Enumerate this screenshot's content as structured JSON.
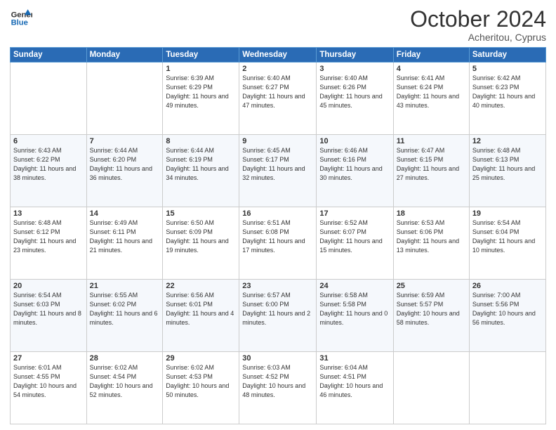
{
  "logo": {
    "line1": "General",
    "line2": "Blue"
  },
  "title": "October 2024",
  "subtitle": "Acheritou, Cyprus",
  "days_of_week": [
    "Sunday",
    "Monday",
    "Tuesday",
    "Wednesday",
    "Thursday",
    "Friday",
    "Saturday"
  ],
  "weeks": [
    [
      {
        "day": "",
        "info": ""
      },
      {
        "day": "",
        "info": ""
      },
      {
        "day": "1",
        "info": "Sunrise: 6:39 AM\nSunset: 6:29 PM\nDaylight: 11 hours and 49 minutes."
      },
      {
        "day": "2",
        "info": "Sunrise: 6:40 AM\nSunset: 6:27 PM\nDaylight: 11 hours and 47 minutes."
      },
      {
        "day": "3",
        "info": "Sunrise: 6:40 AM\nSunset: 6:26 PM\nDaylight: 11 hours and 45 minutes."
      },
      {
        "day": "4",
        "info": "Sunrise: 6:41 AM\nSunset: 6:24 PM\nDaylight: 11 hours and 43 minutes."
      },
      {
        "day": "5",
        "info": "Sunrise: 6:42 AM\nSunset: 6:23 PM\nDaylight: 11 hours and 40 minutes."
      }
    ],
    [
      {
        "day": "6",
        "info": "Sunrise: 6:43 AM\nSunset: 6:22 PM\nDaylight: 11 hours and 38 minutes."
      },
      {
        "day": "7",
        "info": "Sunrise: 6:44 AM\nSunset: 6:20 PM\nDaylight: 11 hours and 36 minutes."
      },
      {
        "day": "8",
        "info": "Sunrise: 6:44 AM\nSunset: 6:19 PM\nDaylight: 11 hours and 34 minutes."
      },
      {
        "day": "9",
        "info": "Sunrise: 6:45 AM\nSunset: 6:17 PM\nDaylight: 11 hours and 32 minutes."
      },
      {
        "day": "10",
        "info": "Sunrise: 6:46 AM\nSunset: 6:16 PM\nDaylight: 11 hours and 30 minutes."
      },
      {
        "day": "11",
        "info": "Sunrise: 6:47 AM\nSunset: 6:15 PM\nDaylight: 11 hours and 27 minutes."
      },
      {
        "day": "12",
        "info": "Sunrise: 6:48 AM\nSunset: 6:13 PM\nDaylight: 11 hours and 25 minutes."
      }
    ],
    [
      {
        "day": "13",
        "info": "Sunrise: 6:48 AM\nSunset: 6:12 PM\nDaylight: 11 hours and 23 minutes."
      },
      {
        "day": "14",
        "info": "Sunrise: 6:49 AM\nSunset: 6:11 PM\nDaylight: 11 hours and 21 minutes."
      },
      {
        "day": "15",
        "info": "Sunrise: 6:50 AM\nSunset: 6:09 PM\nDaylight: 11 hours and 19 minutes."
      },
      {
        "day": "16",
        "info": "Sunrise: 6:51 AM\nSunset: 6:08 PM\nDaylight: 11 hours and 17 minutes."
      },
      {
        "day": "17",
        "info": "Sunrise: 6:52 AM\nSunset: 6:07 PM\nDaylight: 11 hours and 15 minutes."
      },
      {
        "day": "18",
        "info": "Sunrise: 6:53 AM\nSunset: 6:06 PM\nDaylight: 11 hours and 13 minutes."
      },
      {
        "day": "19",
        "info": "Sunrise: 6:54 AM\nSunset: 6:04 PM\nDaylight: 11 hours and 10 minutes."
      }
    ],
    [
      {
        "day": "20",
        "info": "Sunrise: 6:54 AM\nSunset: 6:03 PM\nDaylight: 11 hours and 8 minutes."
      },
      {
        "day": "21",
        "info": "Sunrise: 6:55 AM\nSunset: 6:02 PM\nDaylight: 11 hours and 6 minutes."
      },
      {
        "day": "22",
        "info": "Sunrise: 6:56 AM\nSunset: 6:01 PM\nDaylight: 11 hours and 4 minutes."
      },
      {
        "day": "23",
        "info": "Sunrise: 6:57 AM\nSunset: 6:00 PM\nDaylight: 11 hours and 2 minutes."
      },
      {
        "day": "24",
        "info": "Sunrise: 6:58 AM\nSunset: 5:58 PM\nDaylight: 11 hours and 0 minutes."
      },
      {
        "day": "25",
        "info": "Sunrise: 6:59 AM\nSunset: 5:57 PM\nDaylight: 10 hours and 58 minutes."
      },
      {
        "day": "26",
        "info": "Sunrise: 7:00 AM\nSunset: 5:56 PM\nDaylight: 10 hours and 56 minutes."
      }
    ],
    [
      {
        "day": "27",
        "info": "Sunrise: 6:01 AM\nSunset: 4:55 PM\nDaylight: 10 hours and 54 minutes."
      },
      {
        "day": "28",
        "info": "Sunrise: 6:02 AM\nSunset: 4:54 PM\nDaylight: 10 hours and 52 minutes."
      },
      {
        "day": "29",
        "info": "Sunrise: 6:02 AM\nSunset: 4:53 PM\nDaylight: 10 hours and 50 minutes."
      },
      {
        "day": "30",
        "info": "Sunrise: 6:03 AM\nSunset: 4:52 PM\nDaylight: 10 hours and 48 minutes."
      },
      {
        "day": "31",
        "info": "Sunrise: 6:04 AM\nSunset: 4:51 PM\nDaylight: 10 hours and 46 minutes."
      },
      {
        "day": "",
        "info": ""
      },
      {
        "day": "",
        "info": ""
      }
    ]
  ]
}
